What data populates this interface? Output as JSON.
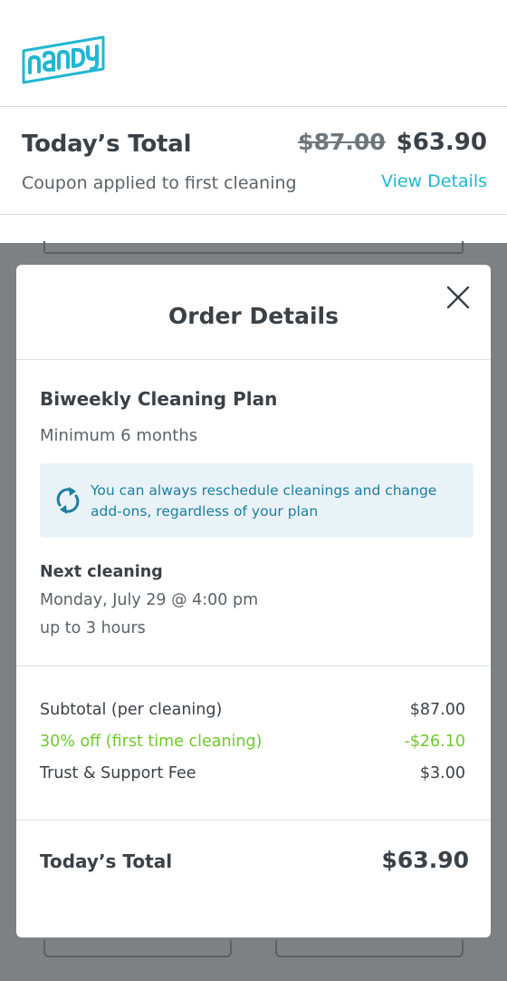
{
  "brand": {
    "logo_text": "handy",
    "color": "#21b6d4"
  },
  "summary": {
    "title": "Today’s Total",
    "original_price": "$87.00",
    "price": "$63.90",
    "coupon_note": "Coupon applied to first cleaning",
    "view_details_label": "View Details"
  },
  "modal": {
    "title": "Order Details",
    "close_icon": "close-icon",
    "plan": {
      "name": "Biweekly Cleaning Plan",
      "minimum": "Minimum 6 months"
    },
    "info": {
      "icon": "refresh-icon",
      "text": "You can always reschedule cleanings and change add-ons, regardless of your plan"
    },
    "next_cleaning": {
      "label": "Next cleaning",
      "date": "Monday, July 29 @ 4:00 pm",
      "duration": "up to 3 hours"
    },
    "line_items": [
      {
        "label": "Subtotal  (per cleaning)",
        "value": "$87.00"
      },
      {
        "label": "30% off (first time cleaning)",
        "value": "-$26.10"
      },
      {
        "label": "Trust & Support Fee",
        "value": "$3.00"
      }
    ],
    "total": {
      "label": "Today’s Total",
      "value": "$63.90"
    }
  },
  "colors": {
    "accent": "#21b6d4",
    "discount": "#6ccb29",
    "info_text": "#1d7ea6",
    "info_bg": "#e9f3f7",
    "overlay": "#7d8183"
  }
}
